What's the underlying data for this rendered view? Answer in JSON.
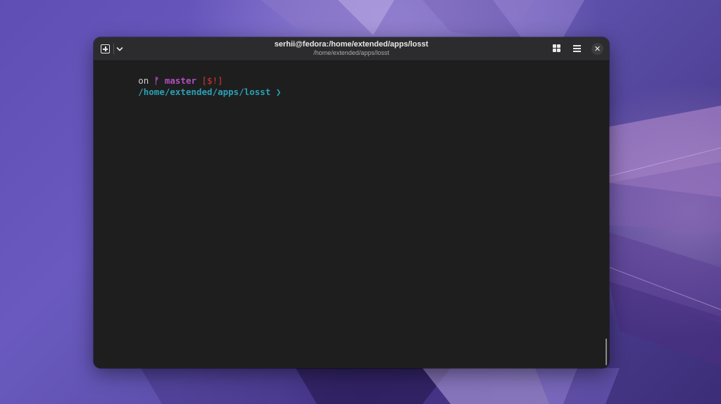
{
  "window": {
    "title": "serhii@fedora:/home/extended/apps/losst",
    "subtitle": "/home/extended/apps/losst"
  },
  "header": {
    "new_tab_icon": "new-tab-icon",
    "menu_icon": "chevron-down-icon",
    "overview_icon": "grid-icon",
    "main_menu_icon": "hamburger-icon",
    "close_glyph": "✕"
  },
  "terminal": {
    "line1": {
      "on": "on ",
      "branch_symbol": "ᚠ",
      "branch_name": " master ",
      "status": "[$!]"
    },
    "line2": {
      "path": "/home/extended/apps/losst",
      "prompt": " ❯"
    }
  },
  "colors": {
    "terminal_bg": "#1e1e1f",
    "headerbar_bg": "#2c2c2e",
    "branch": "#b14fc0",
    "status": "#d9382f",
    "path": "#2aa1b3"
  }
}
